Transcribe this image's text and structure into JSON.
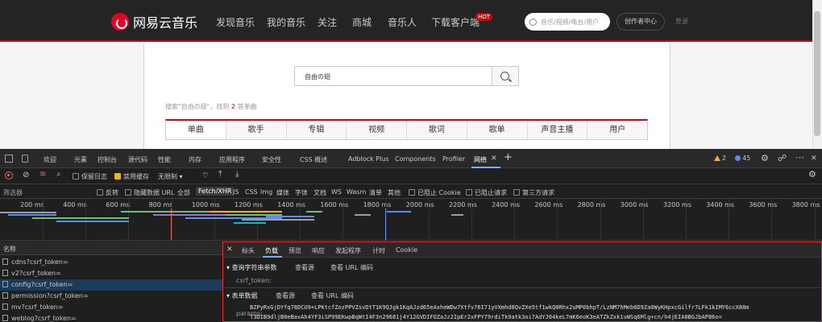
{
  "site": {
    "logo": "网易云音乐",
    "nav": [
      "发现音乐",
      "我的音乐",
      "关注",
      "商城",
      "音乐人",
      "下载客户端"
    ],
    "hot_badge": "HOT",
    "search_placeholder": "音乐/视频/电台/用户",
    "creator_button": "创作者中心",
    "login": "登录"
  },
  "search": {
    "query": "自由の翅",
    "summary_prefix": "搜索\"自由の翅\"，找到",
    "summary_count": "2",
    "summary_suffix": "首单曲",
    "tabs": [
      "单曲",
      "歌手",
      "专辑",
      "视频",
      "歌词",
      "歌单",
      "声音主播",
      "用户"
    ]
  },
  "devtools": {
    "tabs": [
      "欢迎",
      "元素",
      "控制台",
      "源代码",
      "性能",
      "内存",
      "应用程序",
      "安全性",
      "CSS 概述",
      "Adblock Plus",
      "Components",
      "Profiler",
      "网络"
    ],
    "warnings": "2",
    "infos": "45",
    "toolbar": {
      "preserve_log": "保留日志",
      "disable_cache": "禁用缓存",
      "throttle": "无限制"
    },
    "filter": {
      "placeholder": "筛选器",
      "invert": "反转",
      "hide_data_url": "隐藏数据 URL",
      "types": [
        "全部",
        "Fetch/XHR",
        "JS",
        "CSS",
        "Img",
        "媒体",
        "字体",
        "文档",
        "WS",
        "Wasm",
        "清单",
        "其他"
      ],
      "blocked_cookies": "已阻止 Cookie",
      "blocked_requests": "已阻止请求",
      "third_party": "第三方请求"
    },
    "timeline_ticks": [
      "200 ms",
      "400 ms",
      "600 ms",
      "800 ms",
      "1000 ms",
      "1200 ms",
      "1400 ms",
      "1600 ms",
      "1800 ms",
      "2000 ms",
      "2200 ms",
      "2400 ms",
      "2600 ms",
      "2800 ms",
      "3000 ms",
      "3200 ms",
      "3400 ms",
      "3600 ms",
      "3800 ms"
    ],
    "list_header": "名称",
    "requests": [
      "cdns?csrf_token=",
      "v2?csrf_token=",
      "config?csrf_token=",
      "permission?csrf_token=",
      "mv?csrf_token=",
      "weblog?csrf_token="
    ],
    "detail_tabs": [
      "标头",
      "负载",
      "预览",
      "响应",
      "发起程序",
      "计时",
      "Cookie"
    ],
    "query_section": {
      "title": "查询字符串参数",
      "view_source": "查看源",
      "view_url_encoded": "查看 URL 编码",
      "key": "csrf_token:"
    },
    "form_section": {
      "title": "表单数据",
      "view_source": "查看源",
      "view_url_encoded": "查看 URL 编码",
      "key": "params:",
      "line1": "BZPyRxGjDYfq78DCU9+LPKtcfZozPPVZsvDtT1K9QJgk1KqAJzd65eAxheWDw7Xtfv76I71yVXmhd8QvZXe5tf1wkQ0Rhx2uMP0bhpT/LzNM7hMeb6D9Za0WyKHpxcGilfr7LFk1kIMY6ccX88m",
      "line2": "T3DIB9dljB0eBavAh4YF3iSP99EKwpBqWtI4F3n29681j4Y12GVDIFOZaJz2IpEr2xFPY79rdiTk9atk3oi7AdYJ04keL7mK6eoK3eATZkZxk1vWSq6Mlg+cn/h4jEIA0BGJbAP86o="
    }
  }
}
